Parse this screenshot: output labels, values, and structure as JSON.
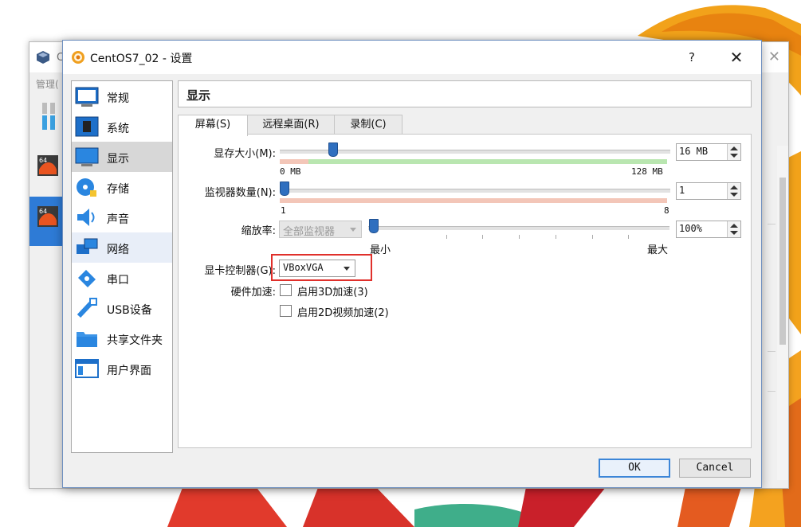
{
  "background": {
    "title_fragment": "C",
    "menu_fragment": "管理(",
    "vm_badge": "64",
    "close_glyph": "✕"
  },
  "dialog": {
    "title": "CentOS7_02 - 设置",
    "help_label": "?",
    "close_label": "✕"
  },
  "sidebar": {
    "items": [
      {
        "label": "常规",
        "icon": "general-icon"
      },
      {
        "label": "系统",
        "icon": "system-chip-icon"
      },
      {
        "label": "显示",
        "icon": "display-monitor-icon"
      },
      {
        "label": "存储",
        "icon": "storage-disk-icon"
      },
      {
        "label": "声音",
        "icon": "audio-speaker-icon"
      },
      {
        "label": "网络",
        "icon": "network-icon"
      },
      {
        "label": "串口",
        "icon": "serial-port-icon"
      },
      {
        "label": "USB设备",
        "icon": "usb-icon"
      },
      {
        "label": "共享文件夹",
        "icon": "shared-folder-icon"
      },
      {
        "label": "用户界面",
        "icon": "user-interface-icon"
      }
    ],
    "selected": "显示"
  },
  "section": {
    "title": "显示"
  },
  "tabs": [
    {
      "label": "屏幕(S)",
      "active": true
    },
    {
      "label": "远程桌面(R)",
      "active": false
    },
    {
      "label": "录制(C)",
      "active": false
    }
  ],
  "screen": {
    "video_memory": {
      "label": "显存大小(M):",
      "value": "16 MB",
      "min_label": "0 MB",
      "max_label": "128 MB",
      "level": 0.125
    },
    "monitor_count": {
      "label": "监视器数量(N):",
      "value": "1",
      "min_label": "1",
      "max_label": "8",
      "level": 0.0
    },
    "scale": {
      "label": "缩放率:",
      "monitor_select": "全部监视器",
      "value": "100%",
      "min_label": "最小",
      "max_label": "最大",
      "level": 0.0
    },
    "graphics_controller": {
      "label": "显卡控制器(G):",
      "value": "VBoxVGA"
    },
    "acceleration": {
      "label": "硬件加速:",
      "enable_3d": {
        "label": "启用3D加速(3)",
        "checked": false
      },
      "enable_2d": {
        "label": "启用2D视频加速(2)",
        "checked": false
      }
    }
  },
  "buttons": {
    "ok": "OK",
    "cancel": "Cancel"
  },
  "colors": {
    "accent": "#2f6fbf",
    "selection": "#d7d7d7",
    "highlight_box": "#e0302b",
    "range_ok": "#b9e6b0",
    "range_warn": "#f3c6b8"
  }
}
